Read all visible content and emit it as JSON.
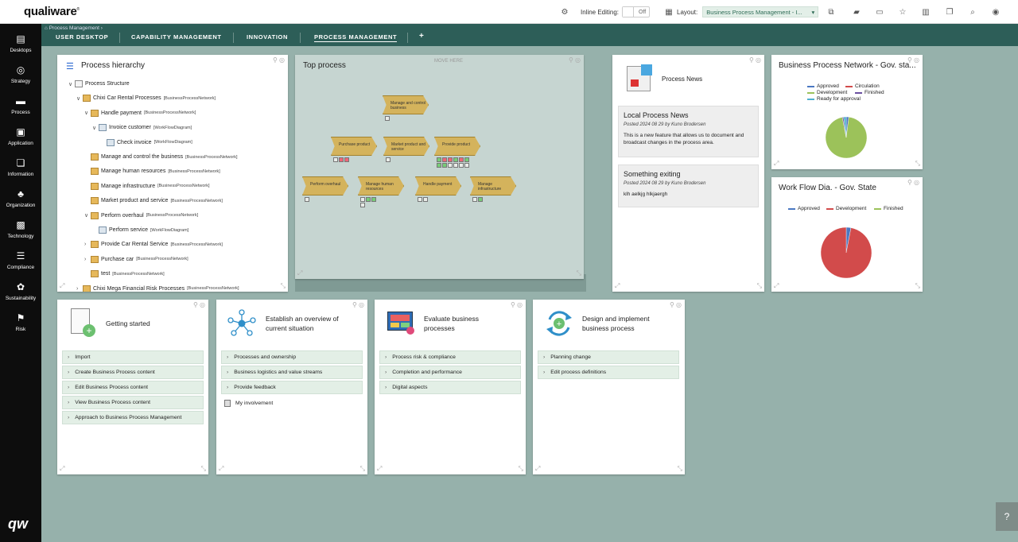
{
  "app": {
    "logo": "qualiware",
    "reg": "®"
  },
  "toolbar": {
    "inline_editing_label": "Inline Editing:",
    "inline_editing_value": "Off",
    "layout_label": "Layout:",
    "layout_value": "Business Process Management - I..."
  },
  "sidebar": {
    "items": [
      {
        "label": "Desktops",
        "icon": "desktops-icon"
      },
      {
        "label": "Strategy",
        "icon": "strategy-icon"
      },
      {
        "label": "Process",
        "icon": "process-icon"
      },
      {
        "label": "Application",
        "icon": "application-icon"
      },
      {
        "label": "Information",
        "icon": "information-icon"
      },
      {
        "label": "Organization",
        "icon": "organization-icon"
      },
      {
        "label": "Technology",
        "icon": "technology-icon"
      },
      {
        "label": "Compliance",
        "icon": "compliance-icon"
      },
      {
        "label": "Sustainability",
        "icon": "sustainability-icon"
      },
      {
        "label": "Risk",
        "icon": "risk-icon"
      }
    ],
    "bottom_logo": "qw"
  },
  "breadcrumb": {
    "text": "Process Management"
  },
  "tabs": [
    {
      "label": "USER DESKTOP"
    },
    {
      "label": "CAPABILITY MANAGEMENT"
    },
    {
      "label": "INNOVATION"
    },
    {
      "label": "PROCESS MANAGEMENT",
      "active": true
    }
  ],
  "add_tab": "+",
  "hierarchy": {
    "title": "Process hierarchy",
    "rows": [
      {
        "toggle": "∨",
        "name": "Process Structure",
        "type": "",
        "icon": "st"
      },
      {
        "toggle": "∨",
        "name": "Chixi Car Rental Processes",
        "type": "[BusinessProcessNetwork]",
        "icon": "bp"
      },
      {
        "toggle": "∨",
        "name": "Handle payment",
        "type": "[BusinessProcessNetwork]",
        "icon": "bp"
      },
      {
        "toggle": "∨",
        "name": "Invoice customer",
        "type": "[WorkFlowDiagram]",
        "icon": "wf"
      },
      {
        "toggle": "",
        "name": "Check invoice",
        "type": "[WorkFlowDiagram]",
        "icon": "wf"
      },
      {
        "toggle": "",
        "name": "Manage and control the business",
        "type": "[BusinessProcessNetwork]",
        "icon": "bp"
      },
      {
        "toggle": "",
        "name": "Manage human resources",
        "type": "[BusinessProcessNetwork]",
        "icon": "bp"
      },
      {
        "toggle": "",
        "name": "Manage infrastructure",
        "type": "[BusinessProcessNetwork]",
        "icon": "bp"
      },
      {
        "toggle": "",
        "name": "Market product and service",
        "type": "[BusinessProcessNetwork]",
        "icon": "bp"
      },
      {
        "toggle": "∨",
        "name": "Perform overhaul",
        "type": "[BusinessProcessNetwork]",
        "icon": "bp"
      },
      {
        "toggle": "",
        "name": "Perform service",
        "type": "[WorkFlowDiagram]",
        "icon": "wf"
      },
      {
        "toggle": "›",
        "name": "Provide Car Rental Service",
        "type": "[BusinessProcessNetwork]",
        "icon": "bp"
      },
      {
        "toggle": "›",
        "name": "Purchase car",
        "type": "[BusinessProcessNetwork]",
        "icon": "bp"
      },
      {
        "toggle": "",
        "name": "test",
        "type": "[BusinessProcessNetwork]",
        "icon": "bp"
      },
      {
        "toggle": "›",
        "name": "Chixi Mega Financial Risk Processes",
        "type": "[BusinessProcessNetwork]",
        "icon": "bp"
      }
    ]
  },
  "top_process": {
    "title": "Top process",
    "move_here": "MOVE HERE",
    "shapes": [
      {
        "label": "Manage and control business"
      },
      {
        "label": "Purchase product"
      },
      {
        "label": "Market product and service"
      },
      {
        "label": "Provide product"
      },
      {
        "label": "Perform overhaul"
      },
      {
        "label": "Manage human resources"
      },
      {
        "label": "Handle payment"
      },
      {
        "label": "Manage infrastructure"
      }
    ]
  },
  "news": {
    "title": "Process News",
    "items": [
      {
        "title": "Local Process News",
        "meta": "Posted 2024 08 29 by Kuno Brodersen",
        "body": "This is a new feature that allows us to document and broadcast changes in the process area."
      },
      {
        "title": "Something exiting",
        "meta": "Posted 2024 08 29 by Kuno Brodersen",
        "body": "klh aelkjg hlkjaergh"
      }
    ]
  },
  "chart_data": [
    {
      "type": "pie",
      "title": "Business Process Network - Gov. sta...",
      "legend": [
        "Approved",
        "Circulation",
        "Development",
        "Finished",
        "Ready for approval"
      ],
      "colors": [
        "#4a78c2",
        "#d24b4b",
        "#9cc25a",
        "#6a4fa0",
        "#4fb0cf"
      ],
      "values": [
        2,
        0,
        95,
        1,
        2
      ]
    },
    {
      "type": "pie",
      "title": "Work Flow Dia. - Gov. State",
      "legend": [
        "Approved",
        "Development",
        "Finished"
      ],
      "colors": [
        "#4a78c2",
        "#d24b4b",
        "#9cc25a"
      ],
      "values": [
        3,
        97,
        0
      ]
    }
  ],
  "cards": [
    {
      "title": "Getting started",
      "icon": "document-add-icon",
      "links": [
        "Import",
        "Create Business Process content",
        "Edit Business Process content",
        "View Business Process content",
        "Approach to Business Process Management"
      ]
    },
    {
      "title": "Establish an overview of current situation",
      "icon": "network-icon",
      "links": [
        "Processes and ownership",
        "Business logistics and value streams",
        "Provide feedback"
      ],
      "extra": "My involvement"
    },
    {
      "title": "Evaluate business processes",
      "icon": "dashboard-icon",
      "links": [
        "Process risk & compliance",
        "Completion and performance",
        "Digital aspects"
      ]
    },
    {
      "title": "Design and implement business process",
      "icon": "cycle-icon",
      "links": [
        "Planning change",
        "Edit process definitions"
      ]
    }
  ],
  "help": "?"
}
